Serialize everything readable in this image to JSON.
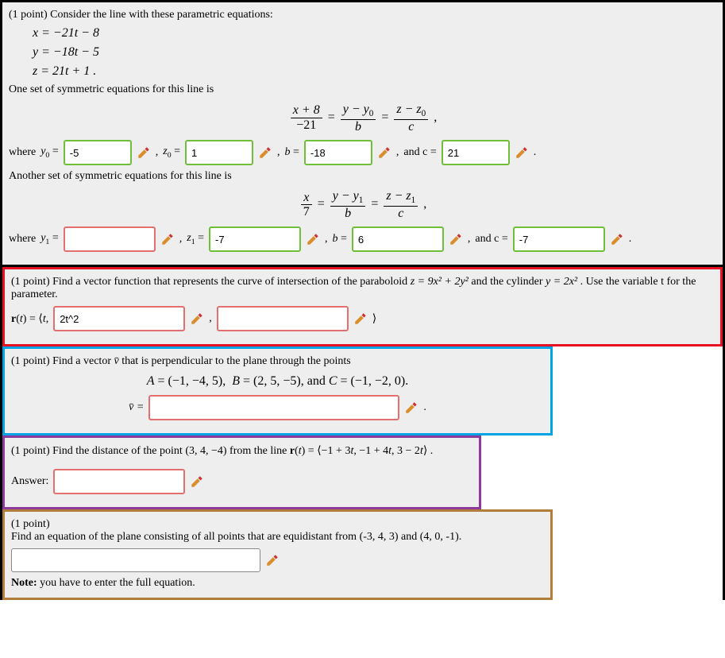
{
  "q1": {
    "points": "(1 point)",
    "intro": "Consider the line with these parametric equations:",
    "eq_x": "x = −21t − 8",
    "eq_y": "y = −18t − 5",
    "eq_z": "z = 21t + 1 .",
    "sym1_intro": "One set of symmetric equations for this line is",
    "sym1_eq_num1": "x + 8",
    "sym1_eq_den1": "−21",
    "sym1_eq_num2": "y − y",
    "sym1_eq_den2": "b",
    "sym1_eq_num3": "z − z",
    "sym1_eq_den3": "c",
    "where": "where",
    "y0_lbl": "y",
    "eq": " = ",
    "y0_val": "-5",
    "z0_lbl": "z",
    "z0_val": "1",
    "b_lbl": "b",
    "b_val": "-18",
    "andc": "and c",
    "c_val": "21",
    "sym2_intro": "Another set of symmetric equations for this line is",
    "sym2_eq_num1": "x",
    "sym2_eq_den1": "7",
    "sym2_eq_num2": "y − y",
    "sym2_eq_den2": "b",
    "sym2_eq_num3": "z − z",
    "sym2_eq_den3": "c",
    "y1_val": "",
    "z1_val": "-7",
    "b2_val": "6",
    "c2_val": "-7",
    "sub0": "0",
    "sub1": "1",
    "comma": ", ",
    "period": "."
  },
  "q2": {
    "points": "(1 point)",
    "text1": "Find a vector function that represents the curve of intersection of the paraboloid ",
    "para": "z = 9x² + 2y²",
    "text2": " and the cylinder ",
    "cyl": "y = 2x²",
    "text3": ". Use the variable t for the parameter.",
    "rt": "r(t) = ⟨t, ",
    "val1": "2t^2",
    "val2": "",
    "close": "⟩",
    "comma": ", "
  },
  "q3": {
    "points": "(1 point)",
    "text": "Find a vector v̄ that is perpendicular to the plane through the points",
    "pts": "A = (−1, −4, 5),  B = (2, 5, −5), and C = (−1, −2, 0).",
    "vlabel": "v̄ = ",
    "val": "",
    "period": "."
  },
  "q4": {
    "points": "(1 point)",
    "text1": "Find the distance of the point ",
    "pt": "(3, 4, −4)",
    "text2": " from the line ",
    "rt": "r(t) = ⟨−1 + 3t, −1 + 4t, 3 − 2t⟩",
    "period": ".",
    "answer": "Answer:",
    "val": ""
  },
  "q5": {
    "points": "(1 point)",
    "text": "Find an equation of the plane consisting of all points that are equidistant from (-3, 4, 3) and (4, 0, -1).",
    "val": "",
    "note_lbl": "Note:",
    "note": " you have to enter the full equation."
  }
}
